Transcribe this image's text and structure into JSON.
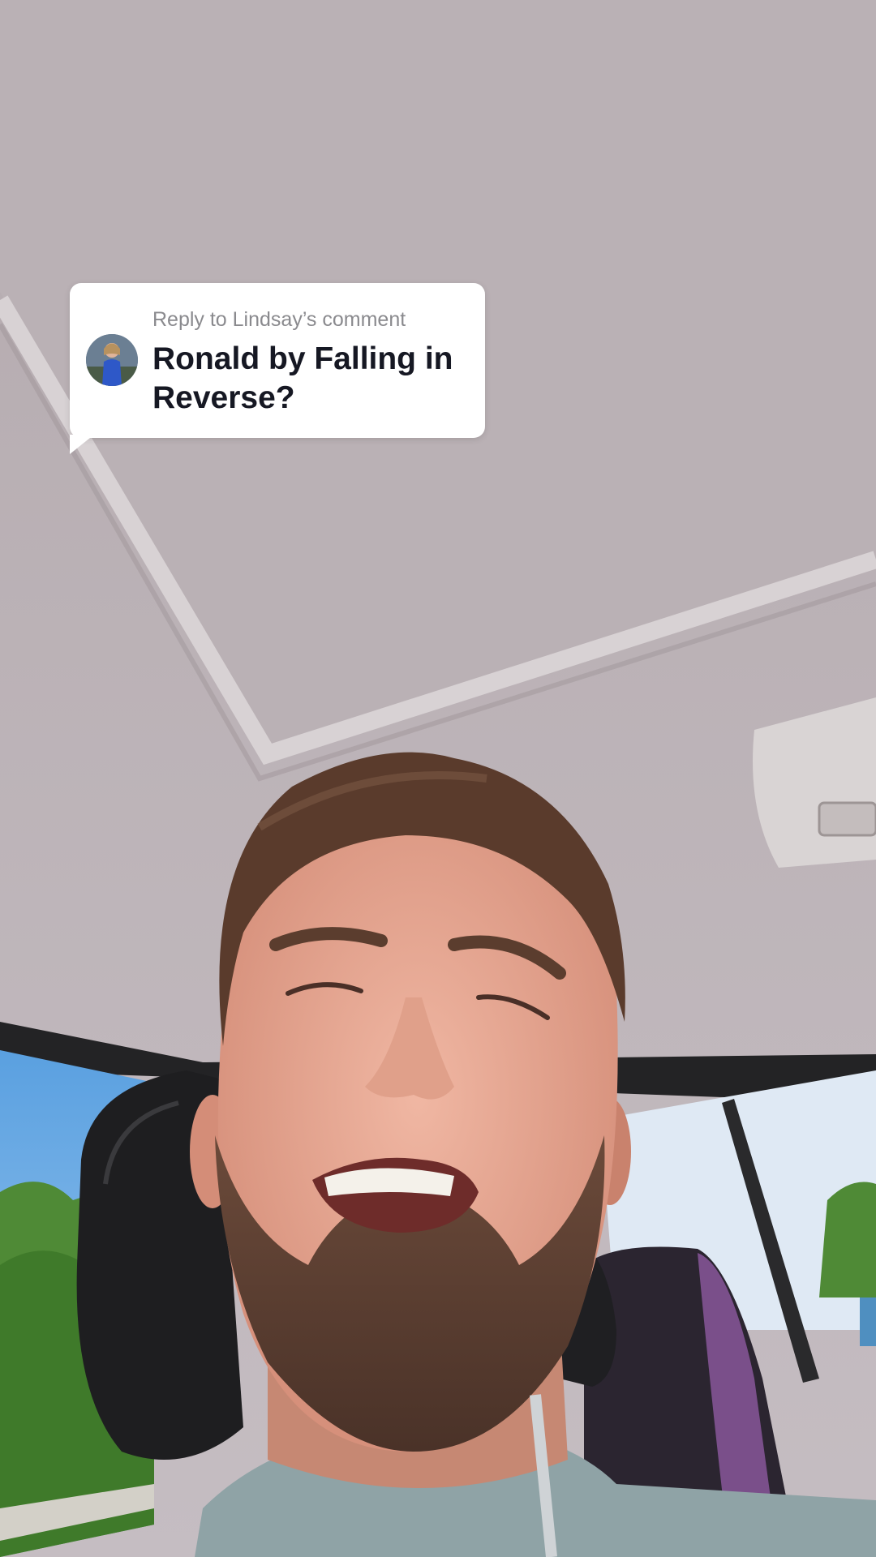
{
  "reply": {
    "label": "Reply to Lindsay’s comment",
    "comment": "Ronald by Falling in Reverse?"
  },
  "colors": {
    "card_background": "#ffffff",
    "label_text": "#8a8a8e",
    "comment_text": "#161823"
  }
}
